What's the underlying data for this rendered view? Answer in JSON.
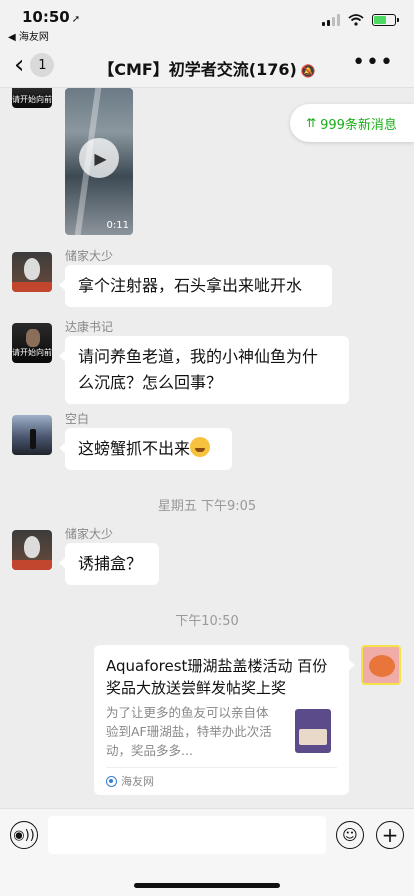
{
  "status_bar": {
    "time": "10:50",
    "location_arrow": "➚",
    "back_to_app": "◀ 海友网",
    "signal_icon": "cellular-signal-icon",
    "wifi_icon": "wifi-icon",
    "battery_icon": "battery-charging-icon",
    "battery_color": "#4cd964"
  },
  "nav": {
    "back_glyph": "‹",
    "unread_count": "1",
    "title": "【CMF】初学者交流(176)",
    "mute_glyph": "🔕",
    "more_glyph": "•••"
  },
  "new_messages": {
    "arrow_glyph": "⇈",
    "label": "999条新消息",
    "color": "#1aad19"
  },
  "messages": [
    {
      "type": "video",
      "avatar_caption": "请开始向前冲",
      "duration": "0:11",
      "play_glyph": "▶"
    },
    {
      "type": "text",
      "sender": "储家大少",
      "text": "拿个注射器，石头拿出来呲开水"
    },
    {
      "type": "text",
      "sender": "达康书记",
      "avatar_caption": "请开始向前冲",
      "text_line1": "请问养鱼老道，我的小神仙鱼为什",
      "text_line2": "么沉底？怎么回事？"
    },
    {
      "type": "text",
      "sender": "空白",
      "text": "这螃蟹抓不出来"
    },
    {
      "type": "timestamp",
      "text": "星期五 下午9:05"
    },
    {
      "type": "text",
      "sender": "储家大少",
      "text": "诱捕盒？"
    },
    {
      "type": "timestamp",
      "text": "下午10:50"
    },
    {
      "type": "link",
      "title": "Aquaforest珊湖盐盖楼活动 百份奖品大放送尝鲜发帖奖上奖",
      "description": "为了让更多的鱼友可以亲自体验到AF珊湖盐，特举办此次活动，奖品多多...",
      "source": "海友网"
    }
  ],
  "input_bar": {
    "voice_glyph": "◉))",
    "emoji_glyph": "☺",
    "plus_glyph": "+"
  }
}
